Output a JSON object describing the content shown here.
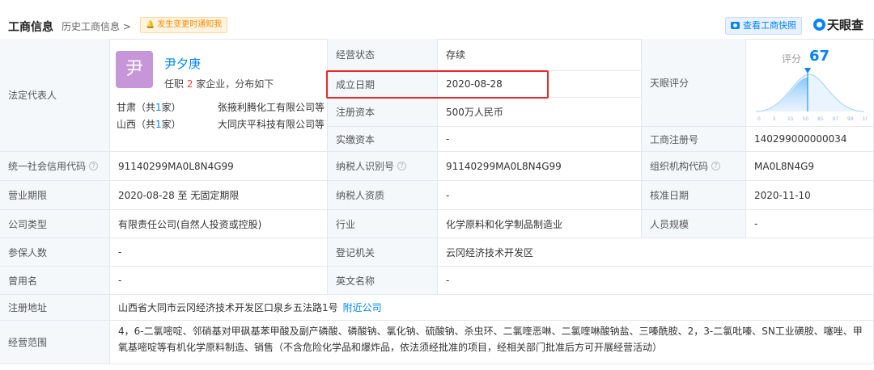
{
  "header": {
    "title": "工商信息",
    "history_link": "历史工商信息 >",
    "notify_btn": "发生变更时通知我",
    "snapshot_btn": "查看工商快照",
    "brand": "天眼查"
  },
  "rep": {
    "label": "法定代表人",
    "avatar_char": "尹",
    "name": "尹夕庚",
    "sub_pre": "任职 ",
    "sub_count": "2",
    "sub_post": " 家企业，分布如下",
    "lines": [
      {
        "prov": "甘肃（共",
        "count": "1",
        "suffix": "家）",
        "company": "张掖利腾化工有限公司等"
      },
      {
        "prov": "山西（共",
        "count": "1",
        "suffix": "家）",
        "company": "大同庆平科技有限公司等"
      }
    ]
  },
  "top_mid": [
    {
      "label": "经营状态",
      "value": "存续"
    },
    {
      "label": "成立日期",
      "value": "2020-08-28"
    },
    {
      "label": "注册资本",
      "value": "500万人民币"
    },
    {
      "label": "实缴资本",
      "value": "-"
    }
  ],
  "score": {
    "label": "天眼评分",
    "prefix": "评分",
    "value": "67",
    "ticks": [
      "0",
      "3",
      "15",
      "50",
      "85",
      "97",
      "99",
      "100"
    ]
  },
  "reg_no": {
    "label": "工商注册号",
    "value": "140299000000034"
  },
  "rows": [
    {
      "a_label": "统一社会信用代码",
      "a_value": "91140299MA0L8N4G99",
      "b_label": "纳税人识别号",
      "b_value": "91140299MA0L8N4G99",
      "c_label": "组织机构代码",
      "c_value": "MA0L8N4G9"
    },
    {
      "a_label": "营业期限",
      "a_value": "2020-08-28  至  无固定期限",
      "b_label": "纳税人资质",
      "b_value": "-",
      "c_label": "核准日期",
      "c_value": "2020-11-10"
    },
    {
      "a_label": "公司类型",
      "a_value": "有限责任公司(自然人投资或控股)",
      "b_label": "行业",
      "b_value": "化学原料和化学制品制造业",
      "c_label": "人员规模",
      "c_value": "-"
    },
    {
      "a_label": "参保人数",
      "a_value": "-",
      "b_label": "登记机关",
      "b_value": "云冈经济技术开发区"
    },
    {
      "a_label": "曾用名",
      "a_value": "-",
      "b_label": "英文名称",
      "b_value": "-"
    }
  ],
  "address": {
    "label": "注册地址",
    "value": "山西省大同市云冈经济技术开发区口泉乡五法路1号",
    "link": "附近公司"
  },
  "scope": {
    "label": "经营范围",
    "value": "4，6-二氯嘧啶、邻硝基对甲砜基苯甲酸及副产磷酸、磷酸钠、氯化钠、硫酸钠、杀虫环、二氯喹恶啉、二氯喹啉酸钠盐、三嗪酰胺、2，3-二氯吡嗪、SN工业磺胺、噻唑、甲氧基嘧啶等有机化学原料制造、销售（不含危险化学品和爆炸品，依法须经批准的项目，经相关部门批准后方可开展经营活动）"
  },
  "colors": {
    "accent": "#0084ff",
    "highlight_box": "#e8292c",
    "label_bg": "#f5f8fb",
    "avatar": "#c696d8"
  }
}
